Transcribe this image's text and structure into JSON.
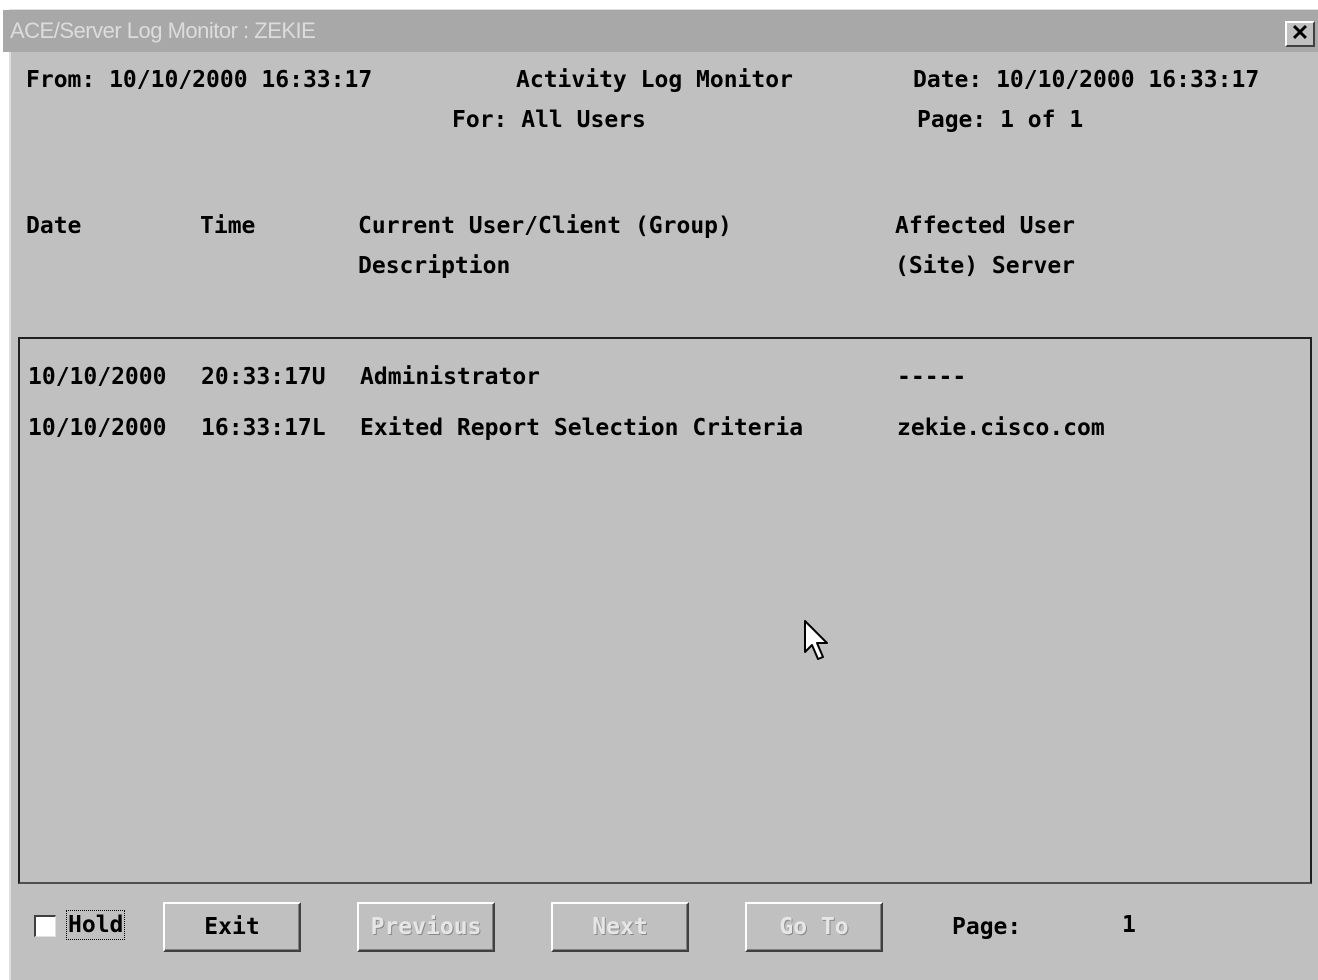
{
  "window": {
    "title": "ACE/Server Log Monitor : ZEKIE",
    "close_glyph": "✕"
  },
  "header": {
    "from": "From: 10/10/2000 16:33:17",
    "title": "Activity Log Monitor",
    "date": "Date: 10/10/2000 16:33:17",
    "for": "For: All Users",
    "page": "Page: 1 of 1"
  },
  "columns": {
    "date": "Date",
    "time": "Time",
    "current_user": "Current User/Client (Group)",
    "description": "Description",
    "affected_user": "Affected User",
    "site_server": "(Site) Server"
  },
  "rows": [
    {
      "date": "10/10/2000",
      "time": "20:33:17U",
      "text": "Administrator",
      "right": "-----"
    },
    {
      "date": "10/10/2000",
      "time": "16:33:17L",
      "text": "Exited Report Selection Criteria",
      "right": "zekie.cisco.com"
    }
  ],
  "footer": {
    "hold_label": "Hold",
    "hold_checked": false,
    "exit_label": "Exit",
    "previous_label": "Previous",
    "next_label": "Next",
    "goto_label": "Go To",
    "page_label": "Page:",
    "page_value": "1"
  },
  "icons": {
    "close": "close-icon",
    "cursor": "mouse-pointer-icon"
  }
}
